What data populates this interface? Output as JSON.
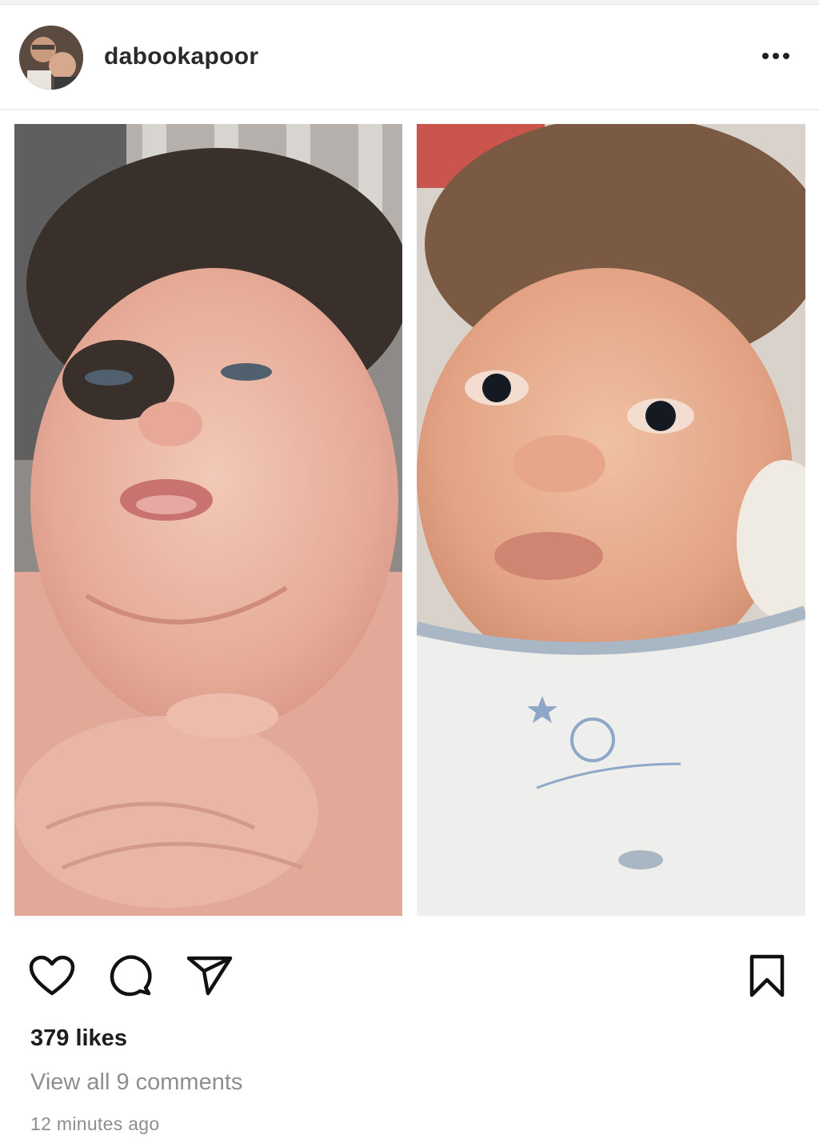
{
  "post": {
    "username": "dabookapoor",
    "likes_text": "379 likes",
    "comments_link": "View all 9 comments",
    "timestamp": "12 minutes ago"
  },
  "icons": {
    "more": "more-options-icon",
    "like": "heart-icon",
    "comment": "comment-bubble-icon",
    "share": "paper-plane-icon",
    "save": "bookmark-icon"
  },
  "colors": {
    "text_primary": "#1d1d1d",
    "text_secondary": "#8e8e8e",
    "divider": "#ececec"
  }
}
